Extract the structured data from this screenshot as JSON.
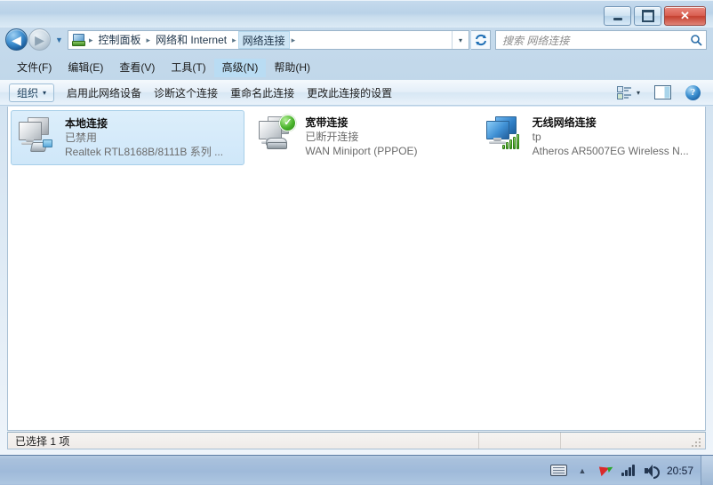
{
  "window": {
    "controls": {
      "minimize": "–",
      "maximize": "□",
      "close": "✕"
    }
  },
  "addressbar": {
    "back_icon": "◀",
    "forward_icon": "▶",
    "history_caret": "▼",
    "location_icon": "network-folder-icon",
    "crumbs": [
      {
        "label": "控制面板",
        "active": false
      },
      {
        "label": "网络和 Internet",
        "active": false
      },
      {
        "label": "网络连接",
        "active": true
      }
    ],
    "separator": "▸",
    "dropdown_caret": "▾",
    "refresh_icon": "↻"
  },
  "search": {
    "placeholder": "搜索 网络连接",
    "icon": "search-icon"
  },
  "menubar": {
    "items": [
      {
        "label": "文件(F)",
        "selected": false
      },
      {
        "label": "编辑(E)",
        "selected": false
      },
      {
        "label": "查看(V)",
        "selected": false
      },
      {
        "label": "工具(T)",
        "selected": false
      },
      {
        "label": "高级(N)",
        "selected": true
      },
      {
        "label": "帮助(H)",
        "selected": false
      }
    ]
  },
  "toolbar": {
    "organize_label": "组织",
    "organize_caret": "▾",
    "actions": [
      "启用此网络设备",
      "诊断这个连接",
      "重命名此连接",
      "更改此连接的设置"
    ],
    "viewmode_caret": "▾",
    "help_glyph": "?"
  },
  "connections": [
    {
      "name": "本地连接",
      "status": "已禁用",
      "device": "Realtek RTL8168B/8111B 系列 ...",
      "selected": true,
      "icon": "lan-adapter-icon"
    },
    {
      "name": "宽带连接",
      "status": "已断开连接",
      "device": "WAN Miniport (PPPOE)",
      "selected": false,
      "icon": "broadband-modem-icon"
    },
    {
      "name": "无线网络连接",
      "status": "tp",
      "device": "Atheros AR5007EG Wireless N...",
      "selected": false,
      "icon": "wireless-adapter-icon"
    }
  ],
  "statusbar": {
    "text": "已选择 1 项"
  },
  "taskbar": {
    "tray": [
      {
        "name": "ime-keyboard-icon"
      },
      {
        "name": "show-hidden-icons-icon",
        "glyph": "▲"
      },
      {
        "name": "flag-action-center-icon"
      },
      {
        "name": "network-signal-icon"
      },
      {
        "name": "volume-speaker-icon"
      }
    ],
    "clock": "20:57"
  },
  "colors": {
    "accent": "#b9dcf3",
    "selection": "#cfe7f9",
    "close_button": "#c4402f",
    "status_green": "#49b32b"
  }
}
